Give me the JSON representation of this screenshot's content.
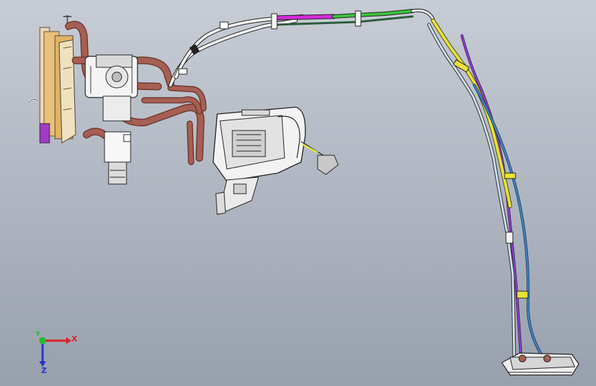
{
  "viewport": {
    "background_top": "#c7ccd5",
    "background_bottom": "#98a0ad"
  },
  "triad": {
    "x_label": "X",
    "y_label": "Y",
    "z_label": "Z",
    "x_color": "#e0202a",
    "y_color": "#1fbf2a",
    "z_color": "#2533c7"
  },
  "palette": {
    "copper_pipe": "#a65f52",
    "copper_dark": "#6e3a30",
    "hose_white": "#f3f3f3",
    "hose_magenta": "#d42ad8",
    "hose_green": "#3cc43c",
    "hose_yellow": "#e8e23a",
    "hose_blue": "#3e86c8",
    "hose_purple": "#8a3fc9",
    "hose_steel": "#8ea9c4",
    "radiator_yellow": "#e8c27a",
    "line_dark": "#1e1e1e"
  }
}
